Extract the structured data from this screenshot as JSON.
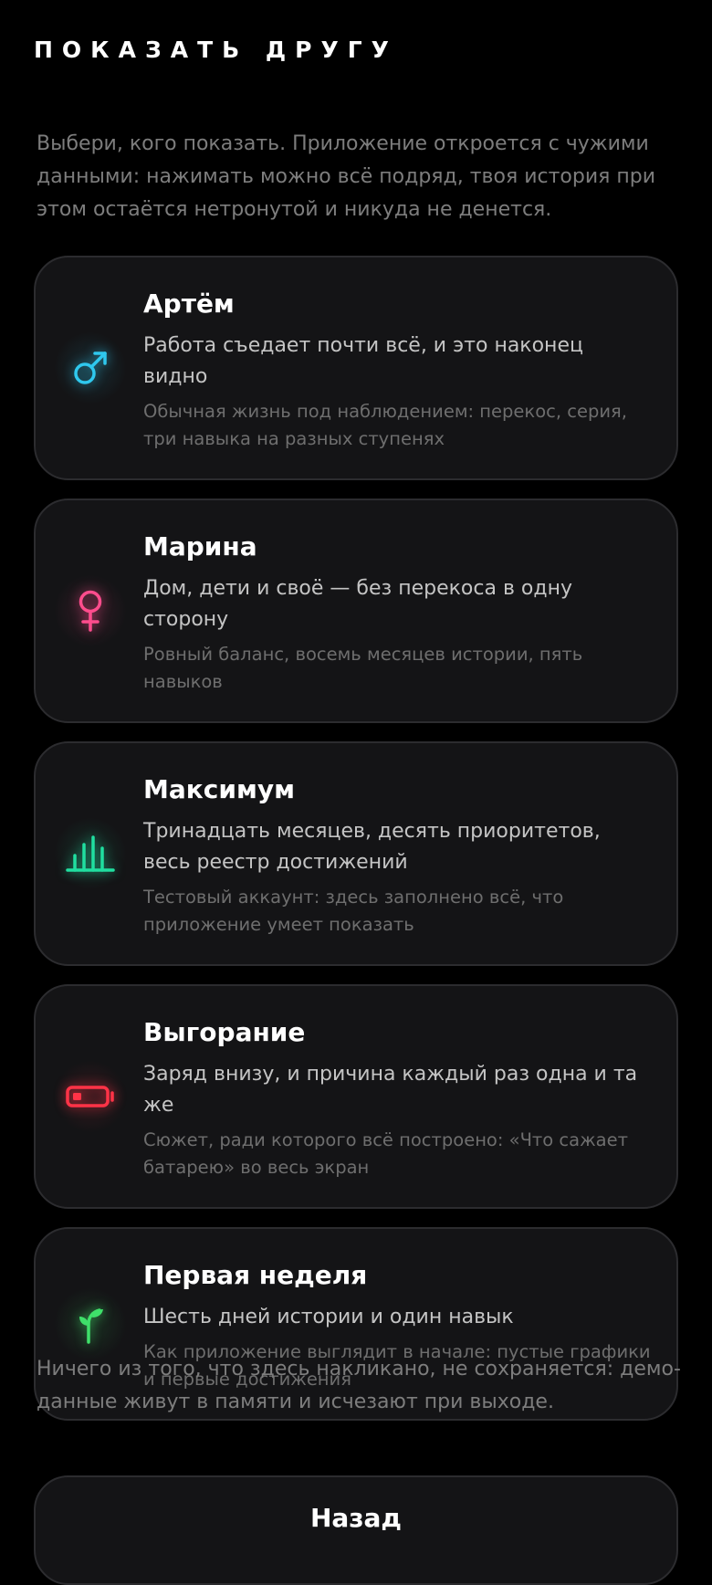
{
  "header": {
    "title": "ПОКАЗАТЬ ДРУГУ"
  },
  "intro": "Выбери, кого показать. Приложение откроется с чужими данными: нажимать можно всё подряд, твоя история при этом остаётся нетронутой и никуда не денется.",
  "profiles": [
    {
      "icon": "male-symbol-icon",
      "color": "#2fc8ee",
      "title": "Артём",
      "subtitle": "Работа съедает почти всё, и это наконец видно",
      "description": "Обычная жизнь под наблюдением: перекос, серия, три навыка на разных ступенях"
    },
    {
      "icon": "female-symbol-icon",
      "color": "#ff4d8d",
      "title": "Марина",
      "subtitle": "Дом, дети и своё — без перекоса в одну сторону",
      "description": "Ровный баланс, восемь месяцев истории, пять навыков"
    },
    {
      "icon": "bar-chart-icon",
      "color": "#20dfa0",
      "title": "Максимум",
      "subtitle": "Тринадцать месяцев, десять приоритетов, весь реестр достижений",
      "description": "Тестовый аккаунт: здесь заполнено всё, что приложение умеет показать"
    },
    {
      "icon": "low-battery-icon",
      "color": "#ff3347",
      "title": "Выгорание",
      "subtitle": "Заряд внизу, и причина каждый раз одна и та же",
      "description": "Сюжет, ради которого всё построено: «Что сажает батарею» во весь экран"
    },
    {
      "icon": "sprout-icon",
      "color": "#3fe06a",
      "title": "Первая неделя",
      "subtitle": "Шесть дней истории и один навык",
      "description": "Как приложение выглядит в начале: пустые графики и первые достижения"
    }
  ],
  "footnote": "Ничего из того, что здесь накликано, не сохраняется: демо-данные живут в памяти и исчезают при выходе.",
  "back_button": {
    "label": "Назад"
  }
}
